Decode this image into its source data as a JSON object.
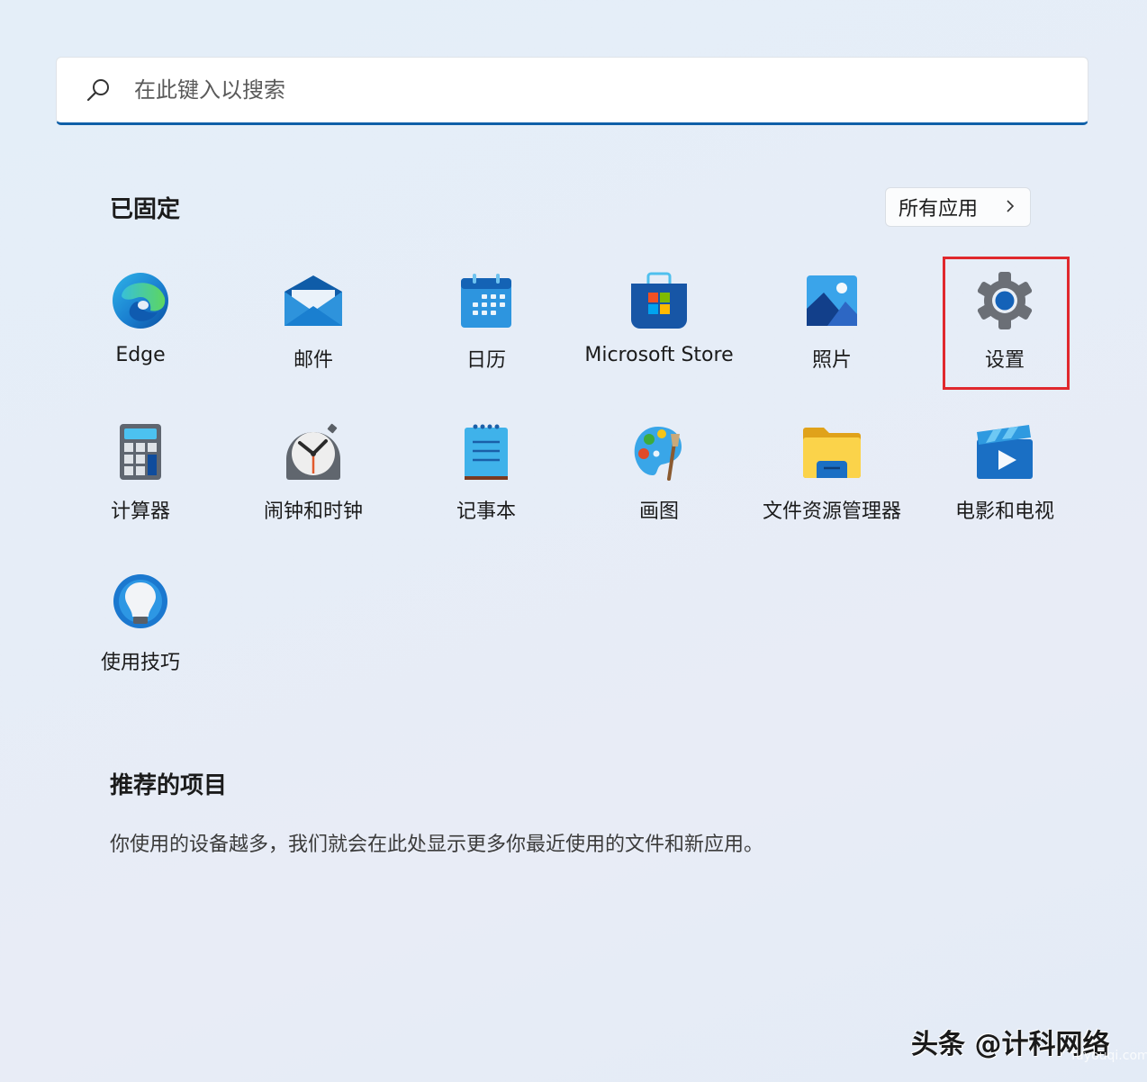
{
  "search": {
    "placeholder": "在此键入以搜索",
    "icon": "search-icon"
  },
  "pinned": {
    "title": "已固定",
    "all_apps_label": "所有应用",
    "all_apps_icon": "chevron-right-icon",
    "apps": [
      {
        "label": "Edge",
        "icon": "edge-icon"
      },
      {
        "label": "邮件",
        "icon": "mail-icon"
      },
      {
        "label": "日历",
        "icon": "calendar-icon"
      },
      {
        "label": "Microsoft Store",
        "icon": "store-icon"
      },
      {
        "label": "照片",
        "icon": "photos-icon"
      },
      {
        "label": "设置",
        "icon": "settings-gear-icon",
        "highlighted": true
      },
      {
        "label": "计算器",
        "icon": "calculator-icon"
      },
      {
        "label": "闹钟和时钟",
        "icon": "alarm-clock-icon"
      },
      {
        "label": "记事本",
        "icon": "notepad-icon"
      },
      {
        "label": "画图",
        "icon": "paint-palette-icon"
      },
      {
        "label": "文件资源管理器",
        "icon": "folder-icon"
      },
      {
        "label": "电影和电视",
        "icon": "movies-tv-icon"
      },
      {
        "label": "使用技巧",
        "icon": "tips-lightbulb-icon"
      }
    ]
  },
  "recommended": {
    "title": "推荐的项目",
    "empty_text": "你使用的设备越多，我们就会在此处显示更多你最近使用的文件和新应用。"
  },
  "highlight_color": "#e0282d",
  "accent_color": "#0f5fa8",
  "watermark": {
    "text": "头条 @计科网络",
    "sub": "fuyouqi.com"
  }
}
